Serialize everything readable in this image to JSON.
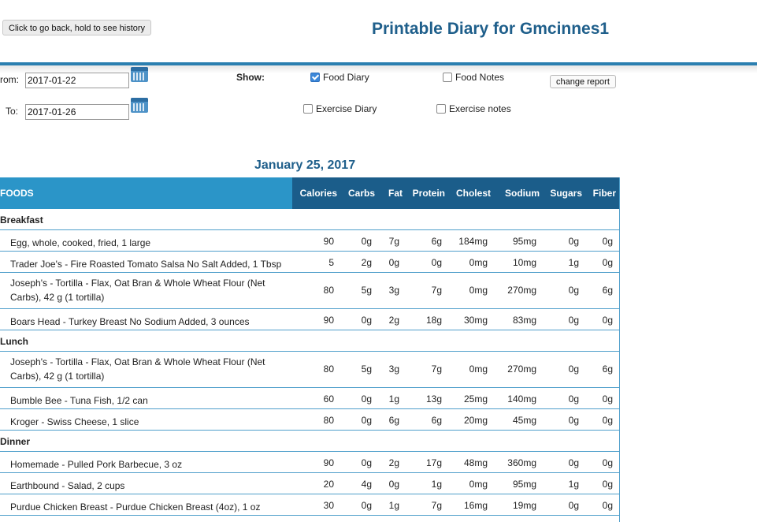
{
  "header": {
    "back_button": "Click to go back, hold to see history",
    "title": "Printable Diary for Gmcinnes1"
  },
  "filters": {
    "from_label": "rom:",
    "from_value": "2017-01-22",
    "to_label": "To:",
    "to_value": "2017-01-26",
    "show_label": "Show:",
    "food_diary": {
      "label": "Food Diary",
      "checked": true
    },
    "food_notes": {
      "label": "Food Notes",
      "checked": false
    },
    "exercise_diary": {
      "label": "Exercise Diary",
      "checked": false
    },
    "exercise_notes": {
      "label": "Exercise notes",
      "checked": false
    },
    "change_report": "change report"
  },
  "diary": {
    "date": "January 25, 2017",
    "columns": [
      "FOODS",
      "Calories",
      "Carbs",
      "Fat",
      "Protein",
      "Cholest",
      "Sodium",
      "Sugars",
      "Fiber"
    ],
    "rows": [
      {
        "type": "section",
        "name": "Breakfast"
      },
      {
        "type": "food",
        "name": "Egg, whole, cooked, fried, 1 large",
        "values": [
          "90",
          "0g",
          "7g",
          "6g",
          "184mg",
          "95mg",
          "0g",
          "0g"
        ]
      },
      {
        "type": "food",
        "name": "Trader Joe's - Fire Roasted Tomato Salsa No Salt Added, 1 Tbsp",
        "values": [
          "5",
          "2g",
          "0g",
          "0g",
          "0mg",
          "10mg",
          "1g",
          "0g"
        ]
      },
      {
        "type": "food",
        "tall": true,
        "name": "Joseph's - Tortilla - Flax, Oat Bran & Whole Wheat Flour (Net Carbs), 42 g (1 tortilla)",
        "values": [
          "80",
          "5g",
          "3g",
          "7g",
          "0mg",
          "270mg",
          "0g",
          "6g"
        ]
      },
      {
        "type": "food",
        "name": "Boars Head - Turkey Breast No Sodium Added, 3 ounces",
        "values": [
          "90",
          "0g",
          "2g",
          "18g",
          "30mg",
          "83mg",
          "0g",
          "0g"
        ]
      },
      {
        "type": "section",
        "name": "Lunch"
      },
      {
        "type": "food",
        "tall": true,
        "name": "Joseph's - Tortilla - Flax, Oat Bran & Whole Wheat Flour (Net Carbs), 42 g (1 tortilla)",
        "values": [
          "80",
          "5g",
          "3g",
          "7g",
          "0mg",
          "270mg",
          "0g",
          "6g"
        ]
      },
      {
        "type": "food",
        "name": "Bumble Bee - Tuna Fish, 1/2 can",
        "values": [
          "60",
          "0g",
          "1g",
          "13g",
          "25mg",
          "140mg",
          "0g",
          "0g"
        ]
      },
      {
        "type": "food",
        "name": "Kroger - Swiss Cheese, 1 slice",
        "values": [
          "80",
          "0g",
          "6g",
          "6g",
          "20mg",
          "45mg",
          "0g",
          "0g"
        ]
      },
      {
        "type": "section",
        "name": "Dinner"
      },
      {
        "type": "food",
        "name": "Homemade - Pulled Pork Barbecue, 3 oz",
        "values": [
          "90",
          "0g",
          "2g",
          "17g",
          "48mg",
          "360mg",
          "0g",
          "0g"
        ]
      },
      {
        "type": "food",
        "name": "Earthbound - Salad, 2 cups",
        "values": [
          "20",
          "4g",
          "0g",
          "1g",
          "0mg",
          "95mg",
          "1g",
          "0g"
        ]
      },
      {
        "type": "food",
        "name": "Purdue Chicken Breast - Purdue Chicken Breast (4oz), 1 oz",
        "values": [
          "30",
          "0g",
          "1g",
          "7g",
          "16mg",
          "19mg",
          "0g",
          "0g"
        ]
      }
    ]
  }
}
